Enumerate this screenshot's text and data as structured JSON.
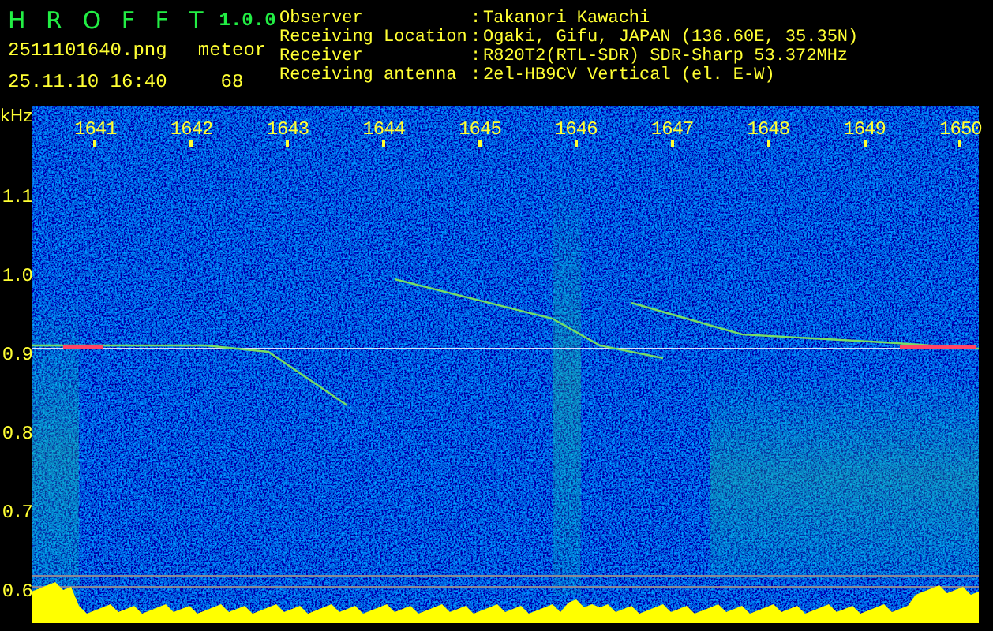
{
  "app": {
    "name": "H R O F F T",
    "version": "1.0.0"
  },
  "file": {
    "name": "2511101640.png",
    "datetime": "25.11.10 16:40"
  },
  "meteor": {
    "label": "meteor",
    "count": "68"
  },
  "info": [
    {
      "label": "Observer",
      "separator": ":",
      "value": "Takanori Kawachi"
    },
    {
      "label": "Receiving Location",
      "separator": ":",
      "value": "Ogaki, Gifu, JAPAN (136.60E, 35.35N)"
    },
    {
      "label": "Receiver",
      "separator": ":",
      "value": "R820T2(RTL-SDR) SDR-Sharp 53.372MHz"
    },
    {
      "label": "Receiving antenna",
      "separator": ":",
      "value": "2el-HB9CV Vertical (el. E-W)"
    }
  ],
  "axis": {
    "unit": "kHz",
    "x_labels": [
      "1641",
      "1642",
      "1643",
      "1644",
      "1645",
      "1646",
      "1647",
      "1648",
      "1649",
      "1650"
    ],
    "y_labels": [
      "1.1",
      "1.0",
      "0.9",
      "0.8",
      "0.7",
      "0.6"
    ]
  }
}
